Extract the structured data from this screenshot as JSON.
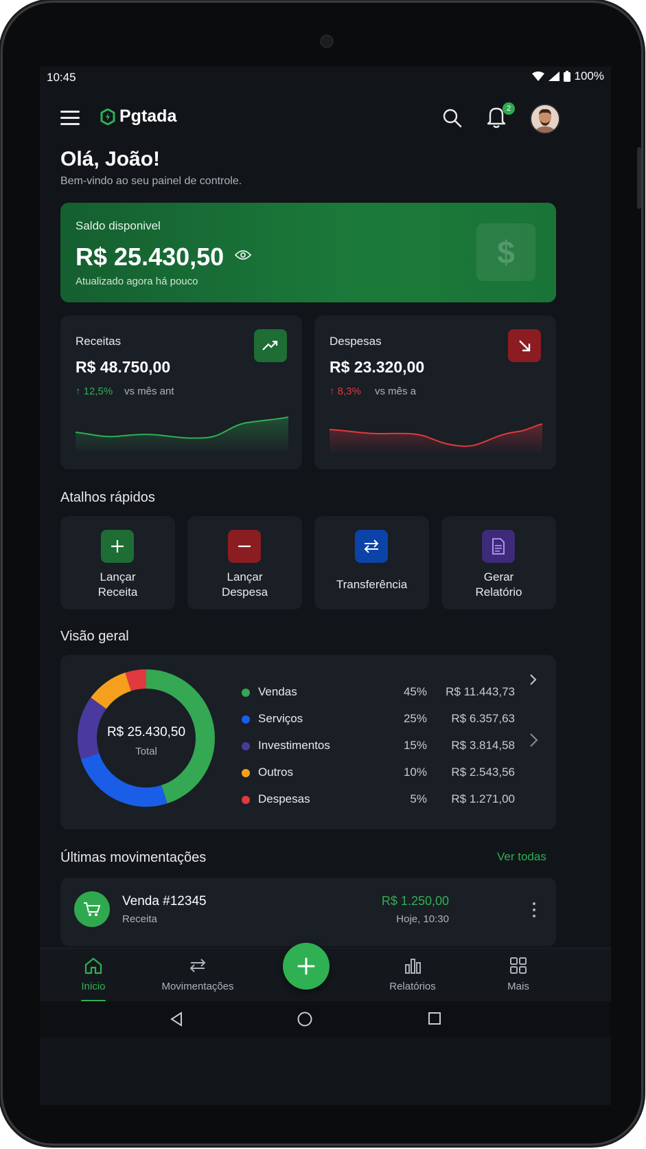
{
  "status_bar": {
    "time": "10:45",
    "battery": "100%"
  },
  "header": {
    "app_name": "Pgtada",
    "notifications_count": "2"
  },
  "greeting": {
    "title": "Olá, João!",
    "subtitle": "Bem-vindo ao seu painel de controle."
  },
  "balance": {
    "label": "Saldo disponivel",
    "amount": "R$ 25.430,50",
    "updated": "Atualizado agora há pouco",
    "icon_symbol": "$"
  },
  "stats": {
    "income": {
      "label": "Receitas",
      "amount": "R$ 48.750,00",
      "change": "↑ 12,5%",
      "comparison": "vs mês ant",
      "color": "#2fb053"
    },
    "expenses": {
      "label": "Despesas",
      "amount": "R$ 23.320,00",
      "change": "↑ 8,3%",
      "comparison": "vs mês a",
      "color": "#e0393e"
    }
  },
  "shortcuts": {
    "title": "Atalhos rápidos",
    "items": [
      {
        "label": "Lançar\nReceita",
        "icon": "plus-icon",
        "color": "#1d6d35"
      },
      {
        "label": "Lançar\nDespesa",
        "icon": "minus-icon",
        "color": "#8b1c22"
      },
      {
        "label": "Transferência",
        "icon": "transfer-icon",
        "color": "#0b43a8"
      },
      {
        "label": "Gerar\nRelatório",
        "icon": "report-icon",
        "color": "#3d2b7a"
      }
    ]
  },
  "overview": {
    "title": "Visão geral",
    "center_value": "R$ 25.430,50",
    "center_label": "Total",
    "legend": [
      {
        "name": "Vendas",
        "pct": "45%",
        "value": "R$ 11.443,73",
        "color": "#34a853"
      },
      {
        "name": "Serviços",
        "pct": "25%",
        "value": "R$ 6.357,63",
        "color": "#1a5ee8"
      },
      {
        "name": "Investimentos",
        "pct": "15%",
        "value": "R$ 3.814,58",
        "color": "#4a3a9e"
      },
      {
        "name": "Outros",
        "pct": "10%",
        "value": "R$ 2.543,56",
        "color": "#f5a01c"
      },
      {
        "name": "Despesas",
        "pct": "5%",
        "value": "R$ 1.271,00",
        "color": "#e0393e"
      }
    ]
  },
  "transactions": {
    "title": "Últimas movimentações",
    "see_all": "Ver todas",
    "items": [
      {
        "title": "Venda #12345",
        "type": "Receita",
        "amount": "R$ 1.250,00",
        "time": "Hoje, 10:30"
      }
    ]
  },
  "bottom_nav": {
    "items": [
      {
        "label": "Inicio",
        "icon": "home-icon",
        "active": true
      },
      {
        "label": "Movimentações",
        "icon": "transfer-icon"
      },
      {
        "label": "Relatórios",
        "icon": "bar-chart-icon"
      },
      {
        "label": "Mais",
        "icon": "grid-icon"
      }
    ]
  }
}
